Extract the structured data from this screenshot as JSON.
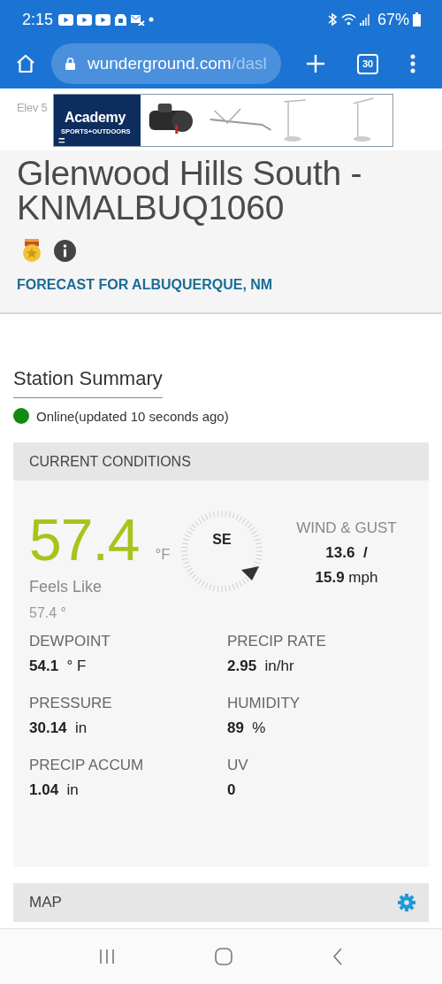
{
  "status_bar": {
    "time": "2:15",
    "battery": "67%"
  },
  "browser": {
    "url_main": "wunderground.com",
    "url_rest": "/dasl",
    "tab_count": "30"
  },
  "ad": {
    "brand": "Academy",
    "tagline": "SPORTS+OUTDOORS",
    "menu_glyph": "="
  },
  "station": {
    "elevation": "Elev 5",
    "title_lines": [
      "Glenwood Hills South -",
      "KNMALBUQ1060"
    ],
    "forecast_link": "FORECAST FOR ALBUQUERQUE, NM"
  },
  "summary": {
    "heading": "Station Summary",
    "online": true,
    "status_text": "Online(updated 10 seconds ago)"
  },
  "current_conditions": {
    "heading": "CURRENT CONDITIONS",
    "temperature": "57.4",
    "temp_unit": "°F",
    "feels_like_label": "Feels Like",
    "feels_like": "57.4 °",
    "wind_direction": "SE",
    "wind_label": "WIND & GUST",
    "wind_speed": "13.6",
    "wind_separator": "/",
    "gust_speed": "15.9",
    "wind_unit": "mph",
    "metrics": [
      {
        "label": "DEWPOINT",
        "value": "54.1",
        "unit": "° F"
      },
      {
        "label": "PRECIP RATE",
        "value": "2.95",
        "unit": "in/hr"
      },
      {
        "label": "PRESSURE",
        "value": "30.14",
        "unit": "in"
      },
      {
        "label": "HUMIDITY",
        "value": "89",
        "unit": "%"
      },
      {
        "label": "PRECIP ACCUM",
        "value": "1.04",
        "unit": "in"
      },
      {
        "label": "UV",
        "value": "0"
      }
    ]
  },
  "map": {
    "heading": "MAP"
  }
}
